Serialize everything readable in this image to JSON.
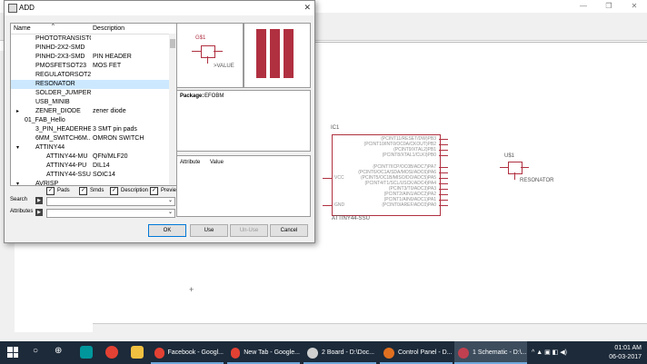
{
  "dialog": {
    "title": "ADD",
    "columns": {
      "name": "Name",
      "description": "Description"
    },
    "tree_rows": [
      {
        "name": "PHOTOTRANSISTO...",
        "desc": "",
        "indent": 1,
        "arrow": "",
        "selected": false
      },
      {
        "name": "PINHD-2X2-SMD",
        "desc": "",
        "indent": 1,
        "arrow": "",
        "selected": false
      },
      {
        "name": "PINHD-2X3-SMD",
        "desc": "PIN HEADER",
        "indent": 1,
        "arrow": "",
        "selected": false
      },
      {
        "name": "PMOSFETSOT23",
        "desc": "MOS FET",
        "indent": 1,
        "arrow": "",
        "selected": false
      },
      {
        "name": "REGULATORSOT23",
        "desc": "",
        "indent": 1,
        "arrow": "",
        "selected": false
      },
      {
        "name": "RESONATOR",
        "desc": "",
        "indent": 1,
        "arrow": "",
        "selected": true
      },
      {
        "name": "SOLDER_JUMPER",
        "desc": "",
        "indent": 1,
        "arrow": "",
        "selected": false
      },
      {
        "name": "USB_MINIB",
        "desc": "",
        "indent": 1,
        "arrow": "",
        "selected": false
      },
      {
        "name": "ZENER_DIODE",
        "desc": "zener diode",
        "indent": 1,
        "arrow": ">",
        "selected": false
      },
      {
        "name": "01_FAB_Hello",
        "desc": "",
        "indent": 0,
        "arrow": "v",
        "selected": false
      },
      {
        "name": "3_PIN_HEADERHE...",
        "desc": "3 SMT pin pads",
        "indent": 1,
        "arrow": "",
        "selected": false
      },
      {
        "name": "6MM_SWITCH6M...",
        "desc": "OMRON SWITCH",
        "indent": 1,
        "arrow": "",
        "selected": false
      },
      {
        "name": "ATTINY44",
        "desc": "",
        "indent": 1,
        "arrow": "v",
        "selected": false
      },
      {
        "name": "ATTINY44-MU",
        "desc": "QFN/MLF20",
        "indent": 2,
        "arrow": "",
        "selected": false
      },
      {
        "name": "ATTINY44-PU",
        "desc": "DIL14",
        "indent": 2,
        "arrow": "",
        "selected": false
      },
      {
        "name": "ATTINY44-SSU",
        "desc": "SOIC14",
        "indent": 2,
        "arrow": "",
        "selected": false
      },
      {
        "name": "AVRISP",
        "desc": "",
        "indent": 1,
        "arrow": "v",
        "selected": false
      }
    ],
    "filters": [
      {
        "label": "Pads",
        "checked": true
      },
      {
        "label": "Smds",
        "checked": true
      },
      {
        "label": "Description",
        "checked": true
      },
      {
        "label": "Preview",
        "checked": true
      }
    ],
    "search_label": "Search",
    "attributes_label": "Attributes",
    "symbol_preview": {
      "name": "G$1",
      "value": ">VALUE"
    },
    "package_label": "Package:",
    "package_name": "EFOBM",
    "attr_columns": {
      "attribute": "Attribute",
      "value": "Value"
    },
    "buttons": {
      "ok": "OK",
      "use": "Use",
      "unuse": "Un-Use",
      "cancel": "Cancel"
    }
  },
  "schematic": {
    "ic_name": "IC1",
    "ic_part": "ATTINY44-SSU",
    "vcc_label": "VCC",
    "gnd_label": "GND",
    "pin_labels": [
      "(PCINT11/RESET/DW)PB3",
      "(PCINT10/INT0/OC0A/CKOUT)PB2",
      "(PCINT9/XTAL2)PB1",
      "(PCINT8/XTAL1/CLKI)PB0",
      "(PCINT7/ICP/OC0B/ADC7)PA7",
      "(PCINT6/OC1A/SDA/MOSI/ADC6)PA6",
      "(PCINT5/OC1B/MISO/DO/ADC5)PA5",
      "(PCINT4/T1/SCL/USCK/ADC4)PA4",
      "(PCINT3/T0/ADC3)PA3",
      "(PCINT2/AIN1/ADC2)PA2",
      "(PCINT1/AIN0/ADC1)PA1",
      "(PCINT0/AREF/ADC0)PA0"
    ],
    "res_name": "U$1",
    "res_part": "RESONATOR"
  },
  "taskbar": {
    "apps": [
      {
        "label": "Facebook - Googl...",
        "color": "#e34133"
      },
      {
        "label": "New Tab - Google...",
        "color": "#e34133"
      },
      {
        "label": "2 Board - D:\\Doc...",
        "color": "#d0d0d0"
      },
      {
        "label": "Control Panel - D...",
        "color": "#e07020"
      },
      {
        "label": "1 Schematic - D:\\...",
        "color": "#c04050"
      }
    ],
    "time": "01:01 AM",
    "date": "06-03-2017"
  }
}
